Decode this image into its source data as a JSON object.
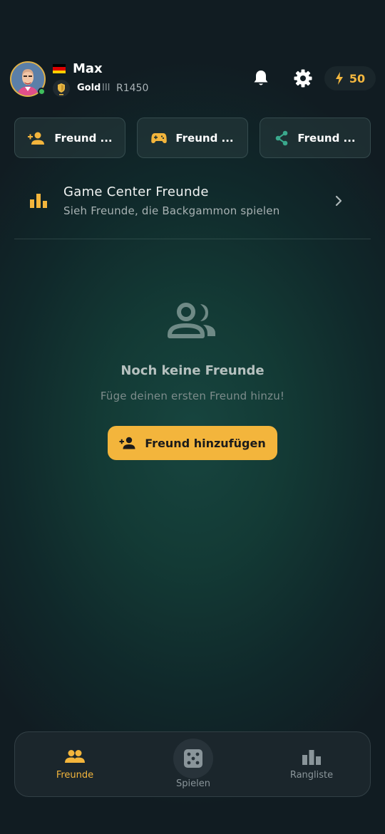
{
  "header": {
    "username": "Max",
    "rank_name": "Gold",
    "rank_tier": "III",
    "rating": "R1450",
    "energy": "50",
    "flag_colors": [
      "#000000",
      "#dd0000",
      "#ffce00"
    ]
  },
  "actions": [
    {
      "label": "Freund ...",
      "icon": "person-add-icon"
    },
    {
      "label": "Freund ...",
      "icon": "gamepad-icon"
    },
    {
      "label": "Freund ...",
      "icon": "share-icon"
    }
  ],
  "game_center": {
    "title": "Game Center Freunde",
    "subtitle": "Sieh Freunde, die Backgammon spielen"
  },
  "empty_state": {
    "title": "Noch keine Freunde",
    "subtitle": "Füge deinen ersten Freund hinzu!",
    "button_label": "Freund hinzufügen"
  },
  "bottom_nav": {
    "friends": "Freunde",
    "play": "Spielen",
    "ranking": "Rangliste"
  },
  "colors": {
    "accent": "#f3b53c",
    "online": "#3fbe5c",
    "share_accent": "#3aa88c"
  }
}
